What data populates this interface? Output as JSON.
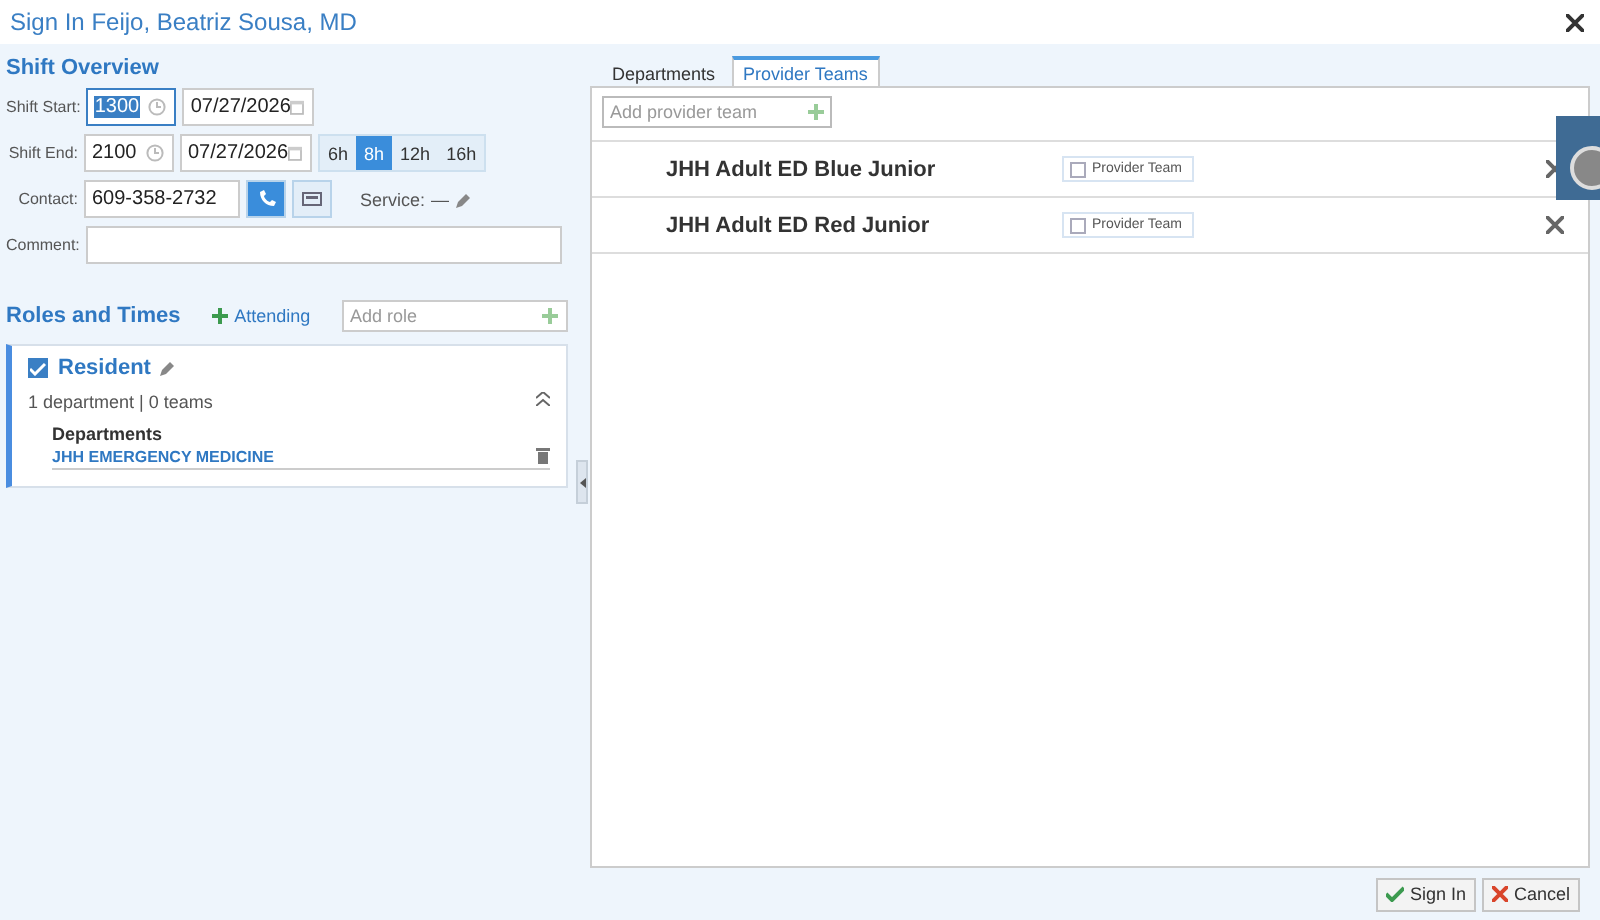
{
  "window": {
    "title": "Sign In Feijo, Beatriz Sousa, MD"
  },
  "shift_overview": {
    "title": "Shift Overview",
    "shift_start": {
      "label": "Shift Start:",
      "time": "1300",
      "date": "07/27/2026"
    },
    "shift_end": {
      "label": "Shift End:",
      "time": "2100",
      "date": "07/27/2026"
    },
    "durations": [
      {
        "label": "6h",
        "selected": false
      },
      {
        "label": "8h",
        "selected": true
      },
      {
        "label": "12h",
        "selected": false
      },
      {
        "label": "16h",
        "selected": false
      }
    ],
    "contact": {
      "label": "Contact:",
      "value": "609-358-2732",
      "phone_selected": true
    },
    "service": {
      "label": "Service:",
      "value": "—"
    },
    "comment": {
      "label": "Comment:"
    }
  },
  "roles": {
    "title": "Roles and Times",
    "add_button": "Attending",
    "add_placeholder": "Add role",
    "items": [
      {
        "name": "Resident",
        "checked": true,
        "summary": "1 department | 0 teams",
        "departments_title": "Departments",
        "departments": [
          "JHH EMERGENCY MEDICINE"
        ]
      }
    ]
  },
  "tabs": [
    {
      "label": "Departments",
      "selected": false
    },
    {
      "label": "Provider Teams",
      "selected": true
    }
  ],
  "team_search": {
    "placeholder": "Add provider team"
  },
  "teams": [
    {
      "name": "JHH Adult ED Blue Junior",
      "tag": "Provider Team",
      "checked": false
    },
    {
      "name": "JHH Adult ED Red Junior",
      "tag": "Provider Team",
      "checked": false
    }
  ],
  "buttons": [
    {
      "kind": "ok",
      "label": "Sign In"
    },
    {
      "kind": "cancel",
      "label": "Cancel"
    }
  ]
}
